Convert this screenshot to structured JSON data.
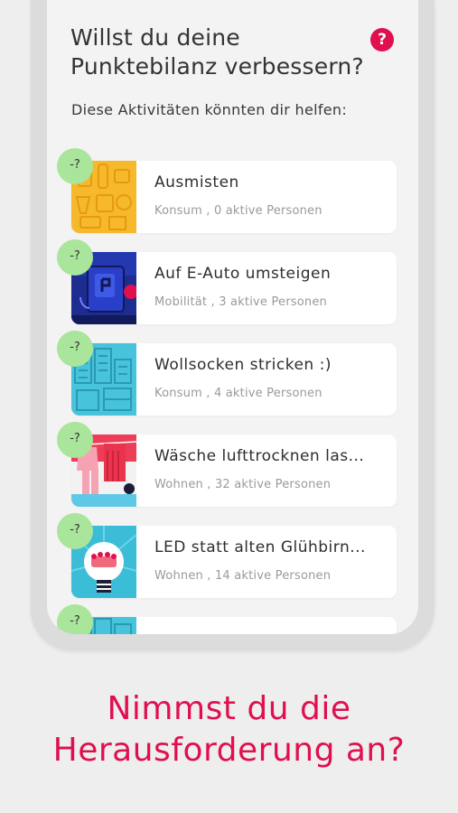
{
  "header": {
    "title_line1": "Willst du deine",
    "title_line2": "Punktebilanz verbessern?",
    "help_label": "?",
    "subtitle": "Diese Aktivitäten könnten dir helfen:"
  },
  "activities": [
    {
      "badge": "-?",
      "title": "Ausmisten",
      "meta": "Konsum , 0 aktive Personen",
      "thumb": "boxes-illustration"
    },
    {
      "badge": "-?",
      "title": "Auf E-Auto umsteigen",
      "meta": "Mobilität , 3 aktive Personen",
      "thumb": "charging-station-illustration"
    },
    {
      "badge": "-?",
      "title": "Wollsocken stricken :)",
      "meta": "Konsum , 4 aktive Personen",
      "thumb": "city-illustration"
    },
    {
      "badge": "-?",
      "title": "Wäsche lufttrocknen las...",
      "meta": "Wohnen , 32 aktive Personen",
      "thumb": "laundry-illustration"
    },
    {
      "badge": "-?",
      "title": "LED statt alten Glühbirn...",
      "meta": "Wohnen , 14 aktive Personen",
      "thumb": "lightbulb-illustration"
    },
    {
      "badge": "-?",
      "title": "",
      "meta": "",
      "thumb": "city-illustration"
    }
  ],
  "cta": {
    "line1": "Nimmst du die",
    "line2": "Herausforderung an?"
  },
  "colors": {
    "accent": "#e0104e",
    "badge": "#a9e59a"
  }
}
